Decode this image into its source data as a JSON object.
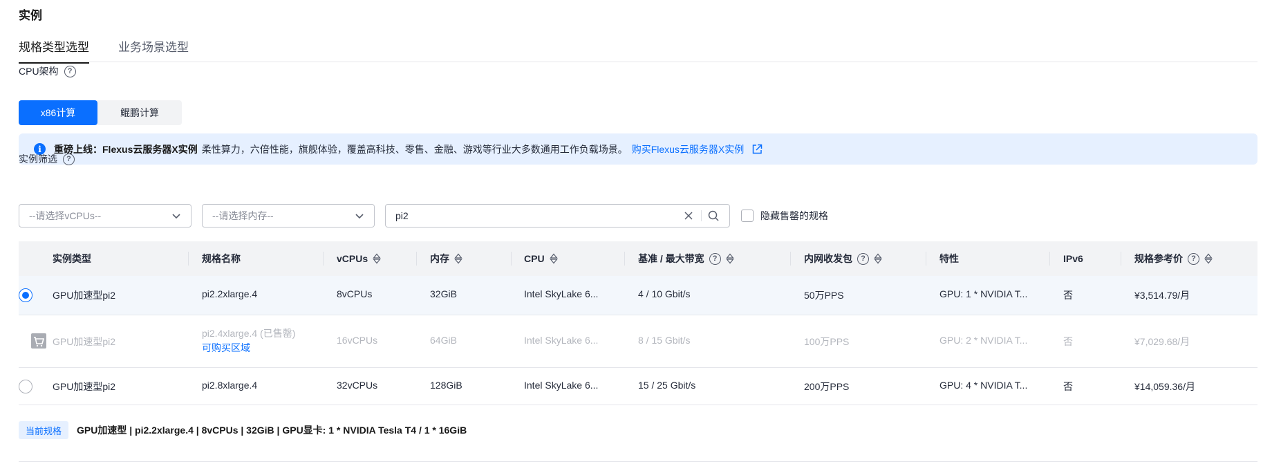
{
  "section_title": "实例",
  "tabs": [
    {
      "label": "规格类型选型",
      "active": true
    },
    {
      "label": "业务场景选型",
      "active": false
    }
  ],
  "cpu_arch": {
    "label": "CPU架构",
    "options": [
      "x86计算",
      "鲲鹏计算"
    ],
    "selected": "x86计算"
  },
  "notice": {
    "bold": "重磅上线：Flexus云服务器X实例",
    "text": "柔性算力，六倍性能，旗舰体验，覆盖高科技、零售、金融、游戏等行业大多数通用工作负载场景。",
    "link": "购买Flexus云服务器X实例"
  },
  "filter": {
    "label": "实例筛选",
    "vcpu_placeholder": "--请选择vCPUs--",
    "memory_placeholder": "--请选择内存--",
    "search_value": "pi2",
    "hide_soldout_label": "隐藏售罄的规格"
  },
  "table": {
    "headers": [
      "实例类型",
      "规格名称",
      "vCPUs",
      "内存",
      "CPU",
      "基准 / 最大带宽",
      "内网收发包",
      "特性",
      "IPv6",
      "规格参考价"
    ],
    "rows": [
      {
        "state": "selected",
        "type": "GPU加速型pi2",
        "name": "pi2.2xlarge.4",
        "vcpus": "8vCPUs",
        "memory": "32GiB",
        "cpu": "Intel SkyLake 6...",
        "bandwidth": "4 / 10 Gbit/s",
        "pps": "50万PPS",
        "feature": "GPU: 1 * NVIDIA T...",
        "ipv6": "否",
        "price": "¥3,514.79/月"
      },
      {
        "state": "soldout",
        "type": "GPU加速型pi2",
        "name": "pi2.4xlarge.4 (已售罄)",
        "buy_link": "可购买区域",
        "vcpus": "16vCPUs",
        "memory": "64GiB",
        "cpu": "Intel SkyLake 6...",
        "bandwidth": "8 / 15 Gbit/s",
        "pps": "100万PPS",
        "feature": "GPU: 2 * NVIDIA T...",
        "ipv6": "否",
        "price": "¥7,029.68/月"
      },
      {
        "state": "unselected",
        "type": "GPU加速型pi2",
        "name": "pi2.8xlarge.4",
        "vcpus": "32vCPUs",
        "memory": "128GiB",
        "cpu": "Intel SkyLake 6...",
        "bandwidth": "15 / 25 Gbit/s",
        "pps": "200万PPS",
        "feature": "GPU: 4 * NVIDIA T...",
        "ipv6": "否",
        "price": "¥14,059.36/月"
      }
    ]
  },
  "current_spec": {
    "badge": "当前规格",
    "text": "GPU加速型 | pi2.2xlarge.4 | 8vCPUs | 32GiB | GPU显卡: 1 * NVIDIA Tesla T4 / 1 * 16GiB"
  },
  "colors": {
    "primary": "#0a6fff",
    "notice_bg": "#e6f0ff",
    "selected_row_bg": "#f3f7fc",
    "header_bg": "#f2f3f5"
  }
}
